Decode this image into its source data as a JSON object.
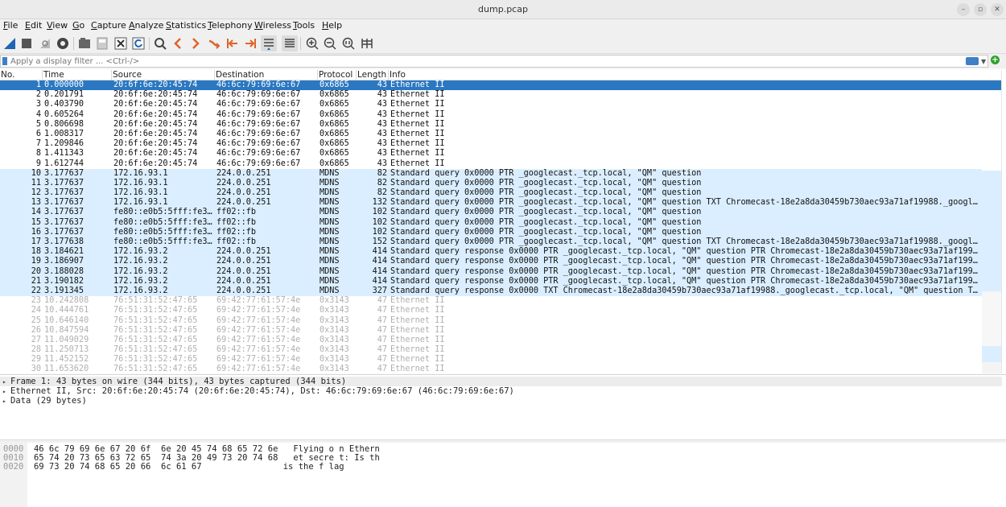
{
  "window": {
    "title": "dump.pcap"
  },
  "menu": [
    "File",
    "Edit",
    "View",
    "Go",
    "Capture",
    "Analyze",
    "Statistics",
    "Telephony",
    "Wireless",
    "Tools",
    "Help"
  ],
  "filter": {
    "placeholder": "Apply a display filter ... <Ctrl-/>"
  },
  "columns": [
    "No.",
    "Time",
    "Source",
    "Destination",
    "Protocol",
    "Length",
    "Info"
  ],
  "packets": [
    {
      "no": "1",
      "time": "0.000000",
      "src": "20:6f:6e:20:45:74",
      "dst": "46:6c:79:69:6e:67",
      "proto": "0x6865",
      "len": "43",
      "info": "Ethernet II",
      "kind": "sel"
    },
    {
      "no": "2",
      "time": "0.201791",
      "src": "20:6f:6e:20:45:74",
      "dst": "46:6c:79:69:6e:67",
      "proto": "0x6865",
      "len": "43",
      "info": "Ethernet II",
      "kind": "eth"
    },
    {
      "no": "3",
      "time": "0.403790",
      "src": "20:6f:6e:20:45:74",
      "dst": "46:6c:79:69:6e:67",
      "proto": "0x6865",
      "len": "43",
      "info": "Ethernet II",
      "kind": "eth"
    },
    {
      "no": "4",
      "time": "0.605264",
      "src": "20:6f:6e:20:45:74",
      "dst": "46:6c:79:69:6e:67",
      "proto": "0x6865",
      "len": "43",
      "info": "Ethernet II",
      "kind": "eth"
    },
    {
      "no": "5",
      "time": "0.806698",
      "src": "20:6f:6e:20:45:74",
      "dst": "46:6c:79:69:6e:67",
      "proto": "0x6865",
      "len": "43",
      "info": "Ethernet II",
      "kind": "eth"
    },
    {
      "no": "6",
      "time": "1.008317",
      "src": "20:6f:6e:20:45:74",
      "dst": "46:6c:79:69:6e:67",
      "proto": "0x6865",
      "len": "43",
      "info": "Ethernet II",
      "kind": "eth"
    },
    {
      "no": "7",
      "time": "1.209846",
      "src": "20:6f:6e:20:45:74",
      "dst": "46:6c:79:69:6e:67",
      "proto": "0x6865",
      "len": "43",
      "info": "Ethernet II",
      "kind": "eth"
    },
    {
      "no": "8",
      "time": "1.411343",
      "src": "20:6f:6e:20:45:74",
      "dst": "46:6c:79:69:6e:67",
      "proto": "0x6865",
      "len": "43",
      "info": "Ethernet II",
      "kind": "eth"
    },
    {
      "no": "9",
      "time": "1.612744",
      "src": "20:6f:6e:20:45:74",
      "dst": "46:6c:79:69:6e:67",
      "proto": "0x6865",
      "len": "43",
      "info": "Ethernet II",
      "kind": "eth"
    },
    {
      "no": "10",
      "time": "3.177637",
      "src": "172.16.93.1",
      "dst": "224.0.0.251",
      "proto": "MDNS",
      "len": "82",
      "info": "Standard query 0x0000 PTR _googlecast._tcp.local, \"QM\" question",
      "kind": "mdns"
    },
    {
      "no": "11",
      "time": "3.177637",
      "src": "172.16.93.1",
      "dst": "224.0.0.251",
      "proto": "MDNS",
      "len": "82",
      "info": "Standard query 0x0000 PTR _googlecast._tcp.local, \"QM\" question",
      "kind": "mdns"
    },
    {
      "no": "12",
      "time": "3.177637",
      "src": "172.16.93.1",
      "dst": "224.0.0.251",
      "proto": "MDNS",
      "len": "82",
      "info": "Standard query 0x0000 PTR _googlecast._tcp.local, \"QM\" question",
      "kind": "mdns"
    },
    {
      "no": "13",
      "time": "3.177637",
      "src": "172.16.93.1",
      "dst": "224.0.0.251",
      "proto": "MDNS",
      "len": "132",
      "info": "Standard query 0x0000 PTR _googlecast._tcp.local, \"QM\" question TXT Chromecast-18e2a8da30459b730aec93a71af19988._googl…",
      "kind": "mdns"
    },
    {
      "no": "14",
      "time": "3.177637",
      "src": "fe80::e0b5:5fff:fe3…",
      "dst": "ff02::fb",
      "proto": "MDNS",
      "len": "102",
      "info": "Standard query 0x0000 PTR _googlecast._tcp.local, \"QM\" question",
      "kind": "mdns"
    },
    {
      "no": "15",
      "time": "3.177637",
      "src": "fe80::e0b5:5fff:fe3…",
      "dst": "ff02::fb",
      "proto": "MDNS",
      "len": "102",
      "info": "Standard query 0x0000 PTR _googlecast._tcp.local, \"QM\" question",
      "kind": "mdns"
    },
    {
      "no": "16",
      "time": "3.177637",
      "src": "fe80::e0b5:5fff:fe3…",
      "dst": "ff02::fb",
      "proto": "MDNS",
      "len": "102",
      "info": "Standard query 0x0000 PTR _googlecast._tcp.local, \"QM\" question",
      "kind": "mdns"
    },
    {
      "no": "17",
      "time": "3.177638",
      "src": "fe80::e0b5:5fff:fe3…",
      "dst": "ff02::fb",
      "proto": "MDNS",
      "len": "152",
      "info": "Standard query 0x0000 PTR _googlecast._tcp.local, \"QM\" question TXT Chromecast-18e2a8da30459b730aec93a71af19988._googl…",
      "kind": "mdns"
    },
    {
      "no": "18",
      "time": "3.184621",
      "src": "172.16.93.2",
      "dst": "224.0.0.251",
      "proto": "MDNS",
      "len": "414",
      "info": "Standard query response 0x0000 PTR _googlecast._tcp.local, \"QM\" question PTR Chromecast-18e2a8da30459b730aec93a71af199…",
      "kind": "mdns"
    },
    {
      "no": "19",
      "time": "3.186907",
      "src": "172.16.93.2",
      "dst": "224.0.0.251",
      "proto": "MDNS",
      "len": "414",
      "info": "Standard query response 0x0000 PTR _googlecast._tcp.local, \"QM\" question PTR Chromecast-18e2a8da30459b730aec93a71af199…",
      "kind": "mdns"
    },
    {
      "no": "20",
      "time": "3.188028",
      "src": "172.16.93.2",
      "dst": "224.0.0.251",
      "proto": "MDNS",
      "len": "414",
      "info": "Standard query response 0x0000 PTR _googlecast._tcp.local, \"QM\" question PTR Chromecast-18e2a8da30459b730aec93a71af199…",
      "kind": "mdns"
    },
    {
      "no": "21",
      "time": "3.190182",
      "src": "172.16.93.2",
      "dst": "224.0.0.251",
      "proto": "MDNS",
      "len": "414",
      "info": "Standard query response 0x0000 PTR _googlecast._tcp.local, \"QM\" question PTR Chromecast-18e2a8da30459b730aec93a71af199…",
      "kind": "mdns"
    },
    {
      "no": "22",
      "time": "3.191345",
      "src": "172.16.93.2",
      "dst": "224.0.0.251",
      "proto": "MDNS",
      "len": "327",
      "info": "Standard query response 0x0000 TXT Chromecast-18e2a8da30459b730aec93a71af19988._googlecast._tcp.local, \"QM\" question T…",
      "kind": "mdns"
    },
    {
      "no": "23",
      "time": "10.242808",
      "src": "76:51:31:52:47:65",
      "dst": "69:42:77:61:57:4e",
      "proto": "0x3143",
      "len": "47",
      "info": "Ethernet II",
      "kind": "grey"
    },
    {
      "no": "24",
      "time": "10.444761",
      "src": "76:51:31:52:47:65",
      "dst": "69:42:77:61:57:4e",
      "proto": "0x3143",
      "len": "47",
      "info": "Ethernet II",
      "kind": "grey"
    },
    {
      "no": "25",
      "time": "10.646140",
      "src": "76:51:31:52:47:65",
      "dst": "69:42:77:61:57:4e",
      "proto": "0x3143",
      "len": "47",
      "info": "Ethernet II",
      "kind": "grey"
    },
    {
      "no": "26",
      "time": "10.847594",
      "src": "76:51:31:52:47:65",
      "dst": "69:42:77:61:57:4e",
      "proto": "0x3143",
      "len": "47",
      "info": "Ethernet II",
      "kind": "grey"
    },
    {
      "no": "27",
      "time": "11.049029",
      "src": "76:51:31:52:47:65",
      "dst": "69:42:77:61:57:4e",
      "proto": "0x3143",
      "len": "47",
      "info": "Ethernet II",
      "kind": "grey"
    },
    {
      "no": "28",
      "time": "11.250713",
      "src": "76:51:31:52:47:65",
      "dst": "69:42:77:61:57:4e",
      "proto": "0x3143",
      "len": "47",
      "info": "Ethernet II",
      "kind": "grey"
    },
    {
      "no": "29",
      "time": "11.452152",
      "src": "76:51:31:52:47:65",
      "dst": "69:42:77:61:57:4e",
      "proto": "0x3143",
      "len": "47",
      "info": "Ethernet II",
      "kind": "grey"
    },
    {
      "no": "30",
      "time": "11.653620",
      "src": "76:51:31:52:47:65",
      "dst": "69:42:77:61:57:4e",
      "proto": "0x3143",
      "len": "47",
      "info": "Ethernet II",
      "kind": "grey"
    }
  ],
  "details": [
    "Frame 1: 43 bytes on wire (344 bits), 43 bytes captured (344 bits)",
    "Ethernet II, Src: 20:6f:6e:20:45:74 (20:6f:6e:20:45:74), Dst: 46:6c:79:69:6e:67 (46:6c:79:69:6e:67)",
    "Data (29 bytes)"
  ],
  "bytes": [
    {
      "offset": "0000",
      "hex": "46 6c 79 69 6e 67 20 6f  6e 20 45 74 68 65 72 6e",
      "ascii": "Flying o n Ethern"
    },
    {
      "offset": "0010",
      "hex": "65 74 20 73 65 63 72 65  74 3a 20 49 73 20 74 68",
      "ascii": "et secre t: Is th"
    },
    {
      "offset": "0020",
      "hex": "69 73 20 74 68 65 20 66  6c 61 67",
      "ascii": "is the f lag"
    }
  ],
  "colors": {
    "selected": "#2b78c2",
    "mdns": "#daeeff",
    "accent": "#3f7fc8"
  }
}
